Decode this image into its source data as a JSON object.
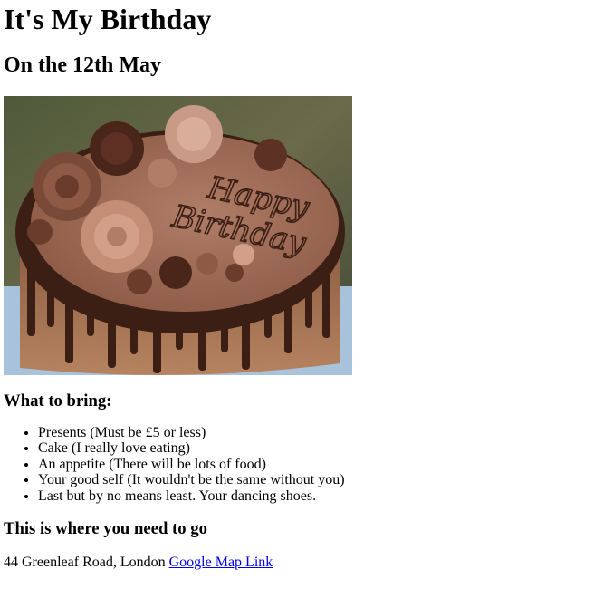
{
  "page": {
    "title": "It's My Birthday",
    "subtitle": "On the 12th May"
  },
  "image": {
    "cake_text_line1": "Happy",
    "cake_text_line2": "Birthday"
  },
  "bring": {
    "heading": "What to bring:",
    "items": [
      "Presents (Must be £5 or less)",
      "Cake (I really love eating)",
      "An appetite (There will be lots of food)",
      "Your good self (It wouldn't be the same without you)",
      "Last but by no means least. Your dancing shoes."
    ]
  },
  "location": {
    "heading": "This is where you need to go",
    "address": "44 Greenleaf Road, London",
    "link_label": "Google Map Link"
  },
  "colors": {
    "link": "#0000ee",
    "text": "#000000",
    "background": "#ffffff"
  }
}
